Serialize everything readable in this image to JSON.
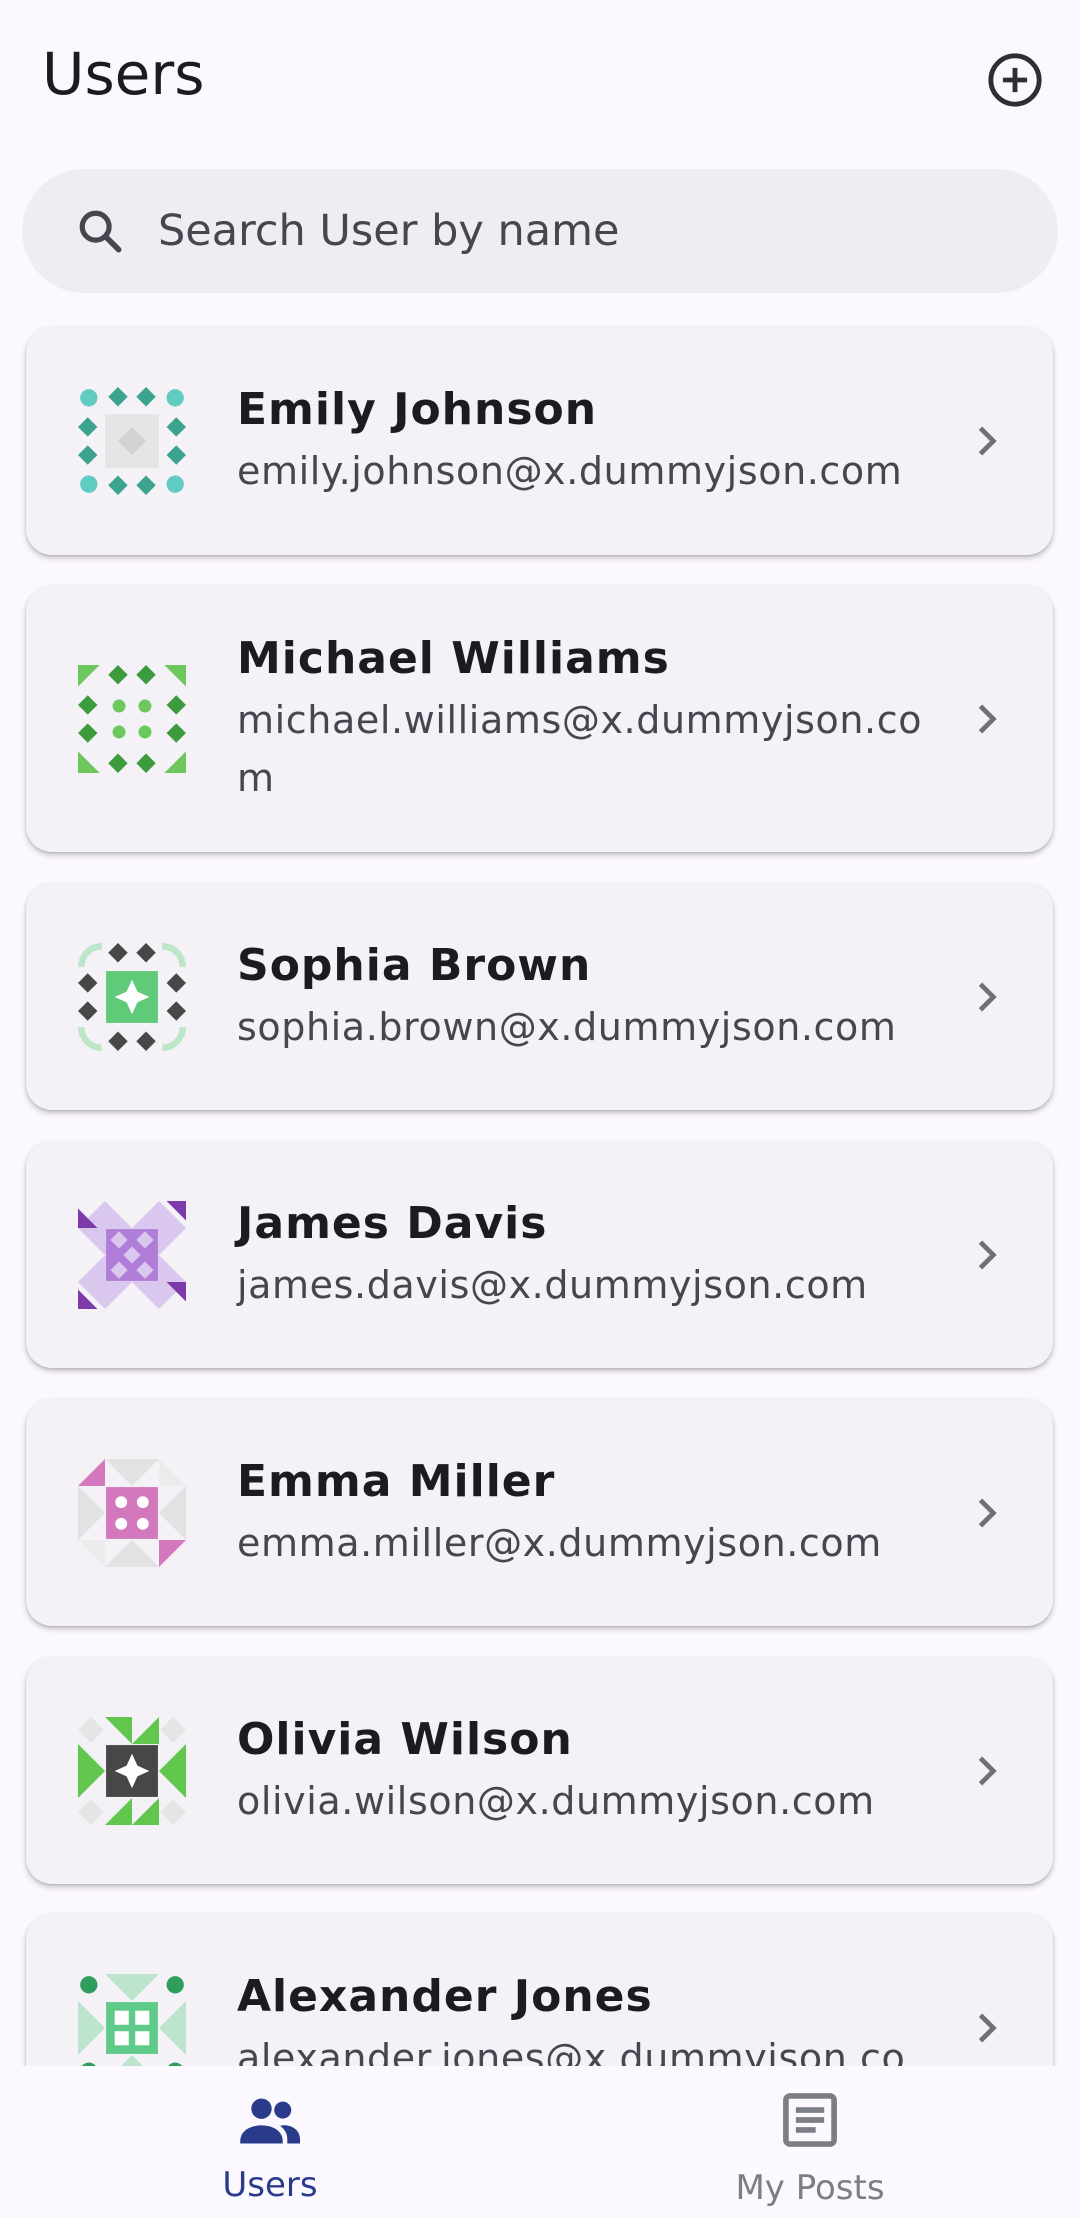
{
  "header": {
    "title": "Users",
    "add_icon": "add-circle-outline-icon"
  },
  "search": {
    "icon": "search-icon",
    "placeholder": "Search User by name",
    "value": ""
  },
  "users": [
    {
      "name": "Emily Johnson",
      "email": "emily.johnson@x.dummyjson.com",
      "avatar_colors": [
        "#3ca38f",
        "#5fcbc1",
        "#e5e5e5"
      ]
    },
    {
      "name": "Michael Williams",
      "email": "michael.williams@x.dummyjson.com",
      "avatar_colors": [
        "#3c9b3c",
        "#6cc75c",
        "#e5e5e5"
      ]
    },
    {
      "name": "Sophia Brown",
      "email": "sophia.brown@x.dummyjson.com",
      "avatar_colors": [
        "#474747",
        "#5fcb78",
        "#bde5c7"
      ]
    },
    {
      "name": "James Davis",
      "email": "james.davis@x.dummyjson.com",
      "avatar_colors": [
        "#7c3aab",
        "#b07ed8",
        "#dac7ee"
      ]
    },
    {
      "name": "Emma Miller",
      "email": "emma.miller@x.dummyjson.com",
      "avatar_colors": [
        "#d478bd",
        "#e0e0e0",
        "#ffffff"
      ]
    },
    {
      "name": "Olivia Wilson",
      "email": "olivia.wilson@x.dummyjson.com",
      "avatar_colors": [
        "#474747",
        "#61c64e",
        "#e5e5e5"
      ]
    },
    {
      "name": "Alexander Jones",
      "email": "alexander.jones@x.dummyjson.com",
      "avatar_colors": [
        "#2f9d5c",
        "#5fcb8a",
        "#bde5cd"
      ]
    }
  ],
  "row_chevron_icon": "chevron-right-icon",
  "bottom_nav": {
    "items": [
      {
        "label": "Users",
        "icon": "people-icon",
        "selected": true
      },
      {
        "label": "My Posts",
        "icon": "article-icon",
        "selected": false
      }
    ]
  },
  "colors": {
    "background": "#fcf8ff",
    "card": "#f4f1f7",
    "search_bar": "#efedf1",
    "primary": "#2b3b8c",
    "text": "#1c1b21",
    "secondary_text": "#45464f"
  }
}
